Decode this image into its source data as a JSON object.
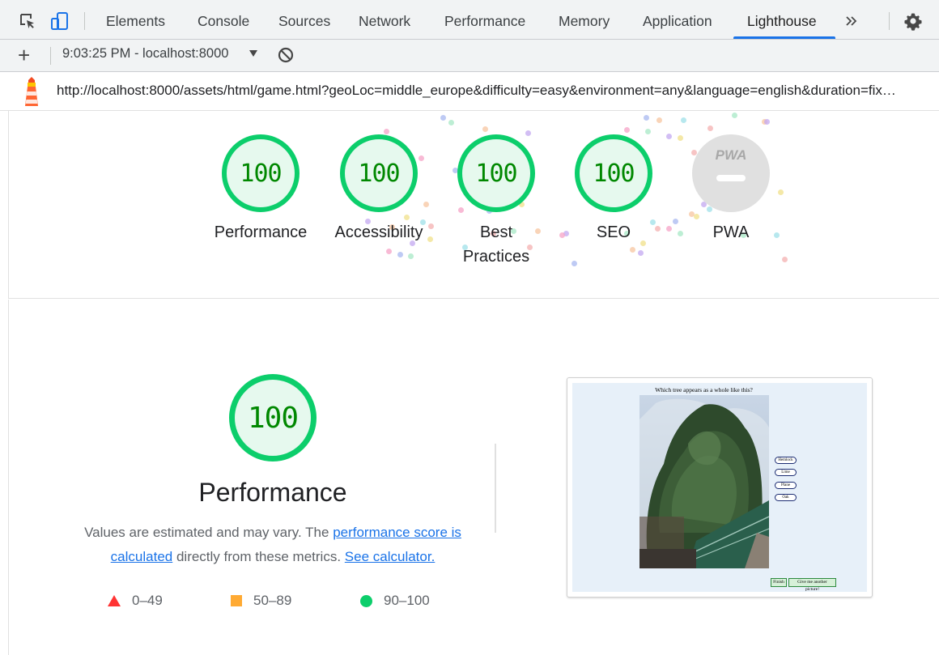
{
  "devtools": {
    "tabs": [
      {
        "label": "Elements"
      },
      {
        "label": "Console"
      },
      {
        "label": "Sources"
      },
      {
        "label": "Network"
      },
      {
        "label": "Performance"
      },
      {
        "label": "Memory"
      },
      {
        "label": "Application"
      },
      {
        "label": "Lighthouse"
      }
    ],
    "active_tab": "Lighthouse",
    "accent": "#1a73e8",
    "icons": [
      "inspect-element-icon",
      "device-toolbar-icon",
      "more-tabs-chevron-icon",
      "settings-gear-icon"
    ]
  },
  "lighthouse_toolbar": {
    "report_selector": "9:03:25 PM - localhost:8000",
    "icons": [
      "add-report-icon",
      "dropdown-caret-icon",
      "clear-reports-icon"
    ]
  },
  "url_bar": {
    "url": "http://localhost:8000/assets/html/game.html?geoLoc=middle_europe&difficulty=easy&environment=any&language=english&duration=fix…"
  },
  "scores": [
    {
      "label": "Performance",
      "value": "100"
    },
    {
      "label": "Accessibility",
      "value": "100"
    },
    {
      "label": "Best Practices",
      "value": "100"
    },
    {
      "label": "SEO",
      "value": "100"
    }
  ],
  "pwa": {
    "label": "PWA",
    "badge": "PWA"
  },
  "performance_section": {
    "score": "100",
    "title": "Performance",
    "desc_prefix": "Values are estimated and may vary. The ",
    "desc_link1": "performance score is calculated",
    "desc_middle": " directly from these metrics. ",
    "desc_link2": "See calculator."
  },
  "legend": [
    {
      "range": "0–49",
      "color": "#ff3333"
    },
    {
      "range": "50–89",
      "color": "#ffaa33"
    },
    {
      "range": "90–100",
      "color": "#0cce6b"
    }
  ],
  "screenshot": {
    "question": "Which tree appears as a whole like this?",
    "options": [
      "Hemlock",
      "Lime",
      "Plane",
      "Oak"
    ],
    "finish_label": "Finish",
    "another_label": "Give me another picture!"
  },
  "colors": {
    "pass_green": "#0cce6b",
    "pass_text": "#008800",
    "pass_bg": "#e6f9ee",
    "link": "#1a73e8"
  }
}
